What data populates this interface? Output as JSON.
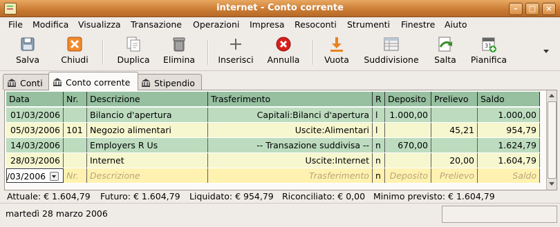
{
  "window": {
    "title": "internet - Conto corrente"
  },
  "menu": [
    {
      "label": "File",
      "key": "F"
    },
    {
      "label": "Modifica",
      "key": "M"
    },
    {
      "label": "Visualizza",
      "key": "V"
    },
    {
      "label": "Transazione",
      "key": "T"
    },
    {
      "label": "Operazioni",
      "key": "O"
    },
    {
      "label": "Impresa",
      "key": "a"
    },
    {
      "label": "Resoconti",
      "key": "R"
    },
    {
      "label": "Strumenti",
      "key": "S"
    },
    {
      "label": "Finestre",
      "key": "n"
    },
    {
      "label": "Aiuto",
      "key": "i"
    }
  ],
  "toolbar": [
    {
      "label": "Salva",
      "icon": "save-icon",
      "enabled": true
    },
    {
      "label": "Chiudi",
      "icon": "close-icon",
      "enabled": true
    },
    {
      "label": "Duplica",
      "icon": "duplicate-icon",
      "enabled": true
    },
    {
      "label": "Elimina",
      "icon": "trash-icon",
      "enabled": true
    },
    {
      "label": "Inserisci",
      "icon": "plus-icon",
      "enabled": true
    },
    {
      "label": "Annulla",
      "icon": "cancel-icon",
      "enabled": true
    },
    {
      "label": "Vuota",
      "icon": "blank-icon",
      "enabled": true
    },
    {
      "label": "Suddivisione",
      "icon": "split-icon",
      "enabled": true
    },
    {
      "label": "Salta",
      "icon": "jump-icon",
      "enabled": true
    },
    {
      "label": "Pianifica",
      "icon": "schedule-icon",
      "enabled": true
    }
  ],
  "tabs": [
    {
      "label": "Conti",
      "active": false
    },
    {
      "label": "Conto corrente",
      "active": true
    },
    {
      "label": "Stipendio",
      "active": false
    }
  ],
  "register": {
    "columns": [
      "Data",
      "Nr.",
      "Descrizione",
      "Trasferimento",
      "R",
      "Deposito",
      "Prelievo",
      "Saldo"
    ],
    "rows": [
      [
        "01/03/2006",
        "",
        "Bilancio d'apertura",
        "Capitali:Bilanci d'apertura",
        "l",
        "1.000,00",
        "",
        "1.000,00"
      ],
      [
        "05/03/2006",
        "101",
        "Negozio alimentari",
        "Uscite:Alimentari",
        "l",
        "",
        "45,21",
        "954,79"
      ],
      [
        "14/03/2006",
        "",
        "Employers R Us",
        "-- Transazione suddivisa --",
        "n",
        "670,00",
        "",
        "1.624,79"
      ],
      [
        "28/03/2006",
        "",
        "Internet",
        "Uscite:Internet",
        "n",
        "",
        "20,00",
        "1.604,79"
      ]
    ],
    "edit_row": {
      "date": "/03/2006",
      "num": "Nr.",
      "desc": "Descrizione",
      "transfer": "Trasferimento",
      "r": "n",
      "deposit": "Deposito",
      "withdrawal": "Prelievo",
      "balance": "Saldo"
    }
  },
  "summary": {
    "attuale": "Attuale: € 1.604,79",
    "futuro": "Futuro: € 1.604,79",
    "liquidato": "Liquidato: € 954,79",
    "riconciliato": "Riconciliato: € 0,00",
    "minimo": "Minimo previsto: € 1.604,79"
  },
  "status": {
    "date": "martedì 28 marzo 2006"
  }
}
